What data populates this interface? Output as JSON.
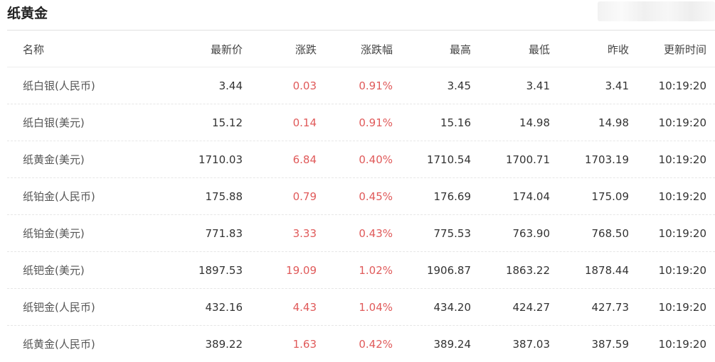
{
  "title": "纸黄金",
  "colors": {
    "up": "#e05a5a",
    "text": "#333333",
    "header": "#444444"
  },
  "columns": [
    "名称",
    "最新价",
    "涨跌",
    "涨跌幅",
    "最高",
    "最低",
    "昨收",
    "更新时间"
  ],
  "rows": [
    {
      "name": "纸白银(人民币)",
      "last": "3.44",
      "change": "0.03",
      "pct": "0.91%",
      "high": "3.45",
      "low": "3.41",
      "prev": "3.41",
      "time": "10:19:20"
    },
    {
      "name": "纸白银(美元)",
      "last": "15.12",
      "change": "0.14",
      "pct": "0.91%",
      "high": "15.16",
      "low": "14.98",
      "prev": "14.98",
      "time": "10:19:20"
    },
    {
      "name": "纸黄金(美元)",
      "last": "1710.03",
      "change": "6.84",
      "pct": "0.40%",
      "high": "1710.54",
      "low": "1700.71",
      "prev": "1703.19",
      "time": "10:19:20"
    },
    {
      "name": "纸铂金(人民币)",
      "last": "175.88",
      "change": "0.79",
      "pct": "0.45%",
      "high": "176.69",
      "low": "174.04",
      "prev": "175.09",
      "time": "10:19:20"
    },
    {
      "name": "纸铂金(美元)",
      "last": "771.83",
      "change": "3.33",
      "pct": "0.43%",
      "high": "775.53",
      "low": "763.90",
      "prev": "768.50",
      "time": "10:19:20"
    },
    {
      "name": "纸钯金(美元)",
      "last": "1897.53",
      "change": "19.09",
      "pct": "1.02%",
      "high": "1906.87",
      "low": "1863.22",
      "prev": "1878.44",
      "time": "10:19:20"
    },
    {
      "name": "纸钯金(人民币)",
      "last": "432.16",
      "change": "4.43",
      "pct": "1.04%",
      "high": "434.20",
      "low": "424.27",
      "prev": "427.73",
      "time": "10:19:20"
    },
    {
      "name": "纸黄金(人民币)",
      "last": "389.22",
      "change": "1.63",
      "pct": "0.42%",
      "high": "389.24",
      "low": "387.03",
      "prev": "387.59",
      "time": "10:19:20"
    }
  ]
}
